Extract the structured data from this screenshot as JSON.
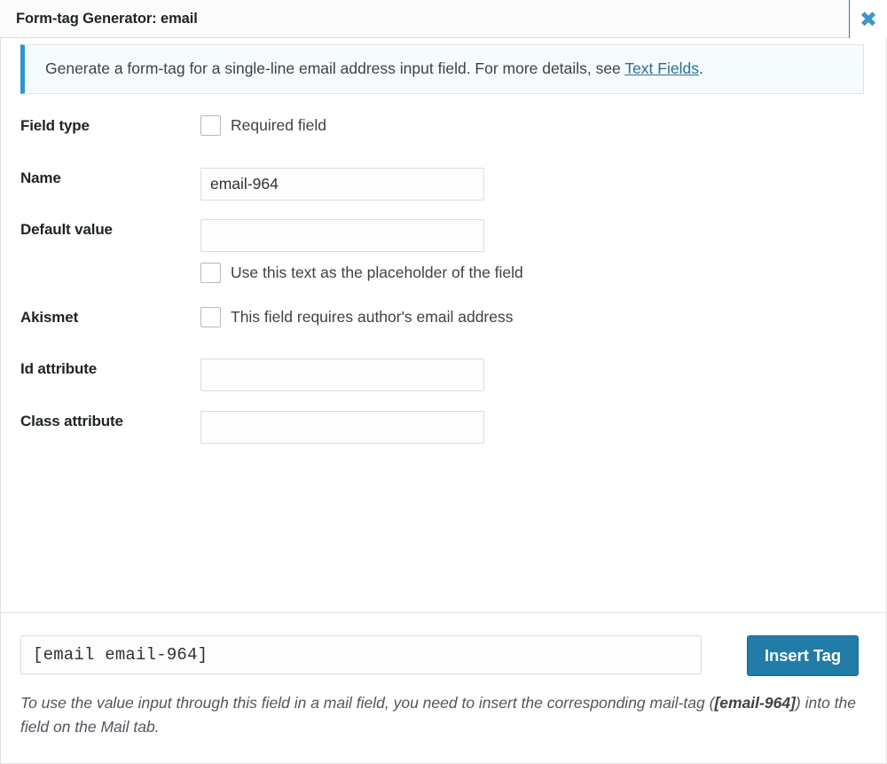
{
  "dialog": {
    "title": "Form-tag Generator: email",
    "close_icon": "close-icon",
    "close_label": "✖"
  },
  "notice": {
    "text_before": "Generate a form-tag for a single-line email address input field. For more details, see ",
    "link_label": "Text Fields",
    "text_after": ".",
    "accent_color": "#2a96d0",
    "background_color": "#f6fbfd"
  },
  "form": {
    "rows": [
      {
        "label": "Field type",
        "control": "checkbox",
        "checkbox_label": "Required field",
        "checked": false
      },
      {
        "label": "Name",
        "control": "text",
        "value": "email-964",
        "placeholder": ""
      },
      {
        "label": "Default value",
        "control": "text",
        "value": "",
        "placeholder": ""
      },
      {
        "label": "",
        "control": "checkbox",
        "checkbox_label": "Use this text as the placeholder of the field",
        "checked": false
      },
      {
        "label": "Akismet",
        "control": "checkbox",
        "checkbox_label": "This field requires author's email address",
        "checked": false
      },
      {
        "label": "Id attribute",
        "control": "text",
        "value": "",
        "placeholder": ""
      },
      {
        "label": "Class attribute",
        "control": "text",
        "value": "",
        "placeholder": ""
      }
    ]
  },
  "footer": {
    "tag_value": "[email email-964]",
    "tag_placeholder": "",
    "insert_label": "Insert Tag",
    "insert_color": "#217ca8",
    "hint_before": "To use the value input through this field in a mail field, you need to insert the corresponding mail-tag (",
    "hint_bold": "[email-964]",
    "hint_after": ") into the field on the Mail tab."
  }
}
